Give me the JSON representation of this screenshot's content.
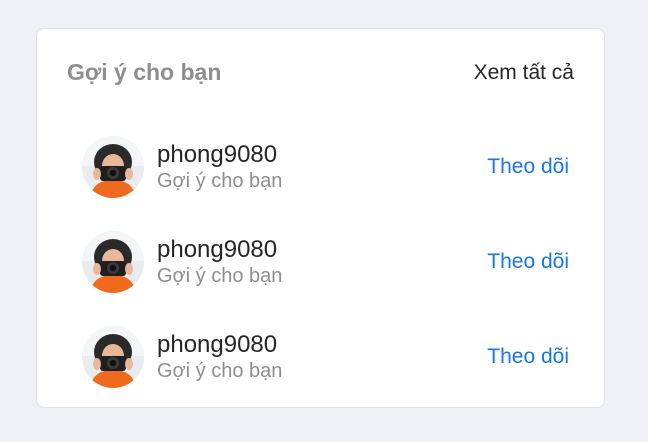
{
  "suggestions": {
    "title": "Gợi ý cho bạn",
    "see_all_label": "Xem tất cả",
    "items": [
      {
        "username": "phong9080",
        "subtitle": "Gợi ý cho bạn",
        "follow_label": "Theo dõi"
      },
      {
        "username": "phong9080",
        "subtitle": "Gợi ý cho bạn",
        "follow_label": "Theo dõi"
      },
      {
        "username": "phong9080",
        "subtitle": "Gợi ý cho bạn",
        "follow_label": "Theo dõi"
      }
    ]
  },
  "colors": {
    "page_background": "#eef0f4",
    "card_background": "#ffffff",
    "link_blue": "#1877e5",
    "muted_text": "#8e8e8e",
    "primary_text": "#262626"
  }
}
